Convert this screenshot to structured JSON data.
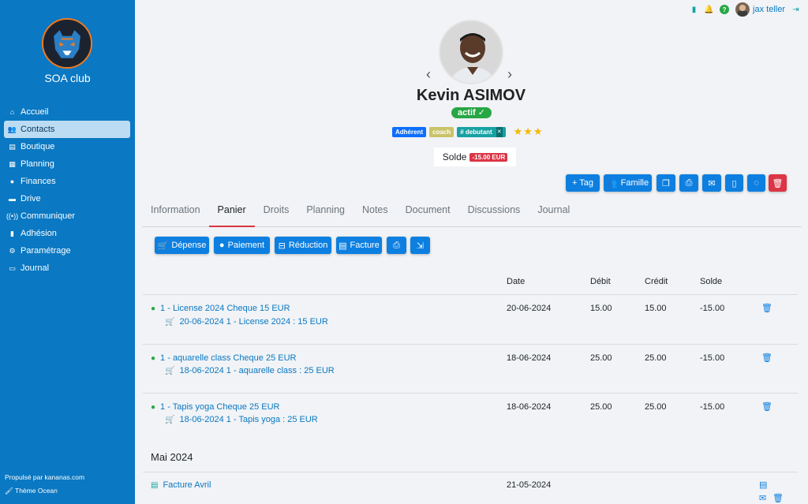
{
  "sidebar": {
    "club_name": "SOA club",
    "items": [
      {
        "label": "Accueil",
        "icon": "home-icon"
      },
      {
        "label": "Contacts",
        "icon": "users-icon"
      },
      {
        "label": "Boutique",
        "icon": "store-icon"
      },
      {
        "label": "Planning",
        "icon": "calendar-icon"
      },
      {
        "label": "Finances",
        "icon": "piggy-bank-icon"
      },
      {
        "label": "Drive",
        "icon": "drive-icon"
      },
      {
        "label": "Communiquer",
        "icon": "broadcast-icon"
      },
      {
        "label": "Adhésion",
        "icon": "id-card-icon"
      },
      {
        "label": "Paramétrage",
        "icon": "gear-icon"
      },
      {
        "label": "Journal",
        "icon": "book-icon"
      }
    ],
    "active_index": 1,
    "footer_line1": "Propulsé par kananas.com",
    "footer_line2": "Thème Ocean"
  },
  "topbar": {
    "user_name": "jax teller"
  },
  "profile": {
    "name": "Kevin ASIMOV",
    "status": "actif ✓",
    "tags": [
      "Adhérent",
      "coach",
      "# debutant"
    ],
    "tag_remove": "✕",
    "stars": "★★★",
    "balance_label": "Solde",
    "balance_value": "-15.00 EUR"
  },
  "actions": {
    "tag": "+ Tag",
    "family": "Famille"
  },
  "tabs": [
    "Information",
    "Panier",
    "Droits",
    "Planning",
    "Notes",
    "Document",
    "Discussions",
    "Journal"
  ],
  "cart_toolbar": {
    "expense": "Dépense",
    "payment": "Paiement",
    "discount": "Réduction",
    "invoice": "Facture"
  },
  "table": {
    "headers": {
      "date": "Date",
      "debit": "Débit",
      "credit": "Crédit",
      "balance": "Solde"
    },
    "rows": [
      {
        "title": "1 - License 2024 Cheque 15 EUR",
        "detail": "20-06-2024 1 - License 2024 : 15 EUR",
        "date": "20-06-2024",
        "debit": "15.00",
        "credit": "15.00",
        "balance": "-15.00"
      },
      {
        "title": "1 - aquarelle class Cheque 25 EUR",
        "detail": "18-06-2024 1 - aquarelle class : 25 EUR",
        "date": "18-06-2024",
        "debit": "25.00",
        "credit": "25.00",
        "balance": "-15.00"
      },
      {
        "title": "1 - Tapis yoga Cheque 25 EUR",
        "detail": "18-06-2024 1 - Tapis yoga : 25 EUR",
        "date": "18-06-2024",
        "debit": "25.00",
        "credit": "25.00",
        "balance": "-15.00"
      }
    ],
    "section_title": "Mai 2024",
    "invoice_row": {
      "title": "Facture Avril",
      "date": "21-05-2024"
    }
  },
  "colors": {
    "sidebar": "#0a78c2",
    "primary": "#0d7fe0",
    "danger": "#dc3545",
    "success": "#28a745"
  }
}
